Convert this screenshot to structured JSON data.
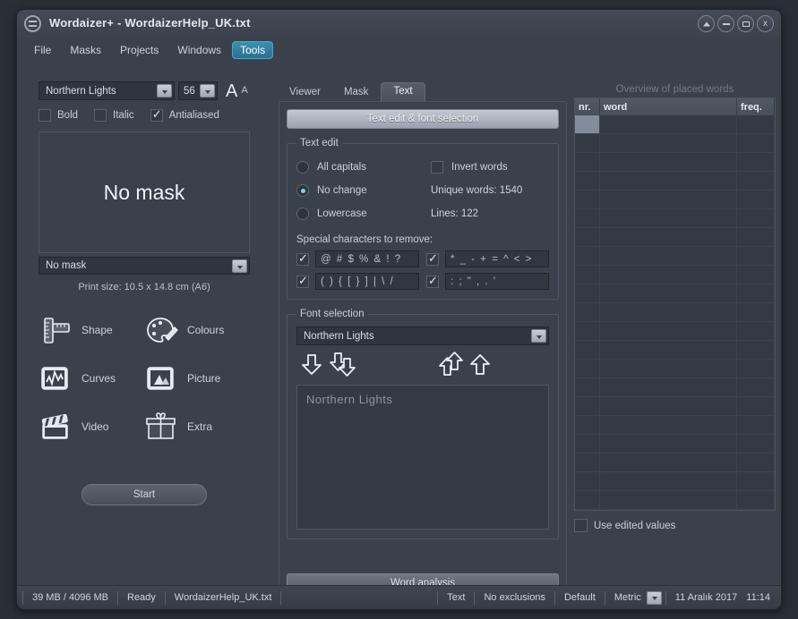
{
  "window": {
    "title": "Wordaizer+ - WordaizerHelp_UK.txt",
    "app_icon": "menu-circle-icon",
    "controls": [
      {
        "name": "rollup-button",
        "glyph": "▲"
      },
      {
        "name": "minimize-button",
        "glyph": "–"
      },
      {
        "name": "maximize-button",
        "glyph": "□"
      },
      {
        "name": "close-button",
        "glyph": "x"
      }
    ]
  },
  "menubar": {
    "items": [
      {
        "label": "File",
        "active": false
      },
      {
        "label": "Masks",
        "active": false
      },
      {
        "label": "Projects",
        "active": false
      },
      {
        "label": "Windows",
        "active": false
      },
      {
        "label": "Tools",
        "active": true
      }
    ],
    "active_color": "#2b7091"
  },
  "left_panel": {
    "font_name": "Northern Lights",
    "font_size": "56",
    "font_big_a": "A",
    "font_small_a": "A",
    "style_checks": [
      {
        "label": "Bold",
        "checked": false
      },
      {
        "label": "Italic",
        "checked": false
      },
      {
        "label": "Antialiased",
        "checked": true
      }
    ],
    "mask_preview_text": "No mask",
    "mask_select_value": "No mask",
    "print_size": "Print size: 10.5 x 14.8 cm (A6)",
    "tools": [
      {
        "label": "Shape",
        "icon": "ruler-icon"
      },
      {
        "label": "Colours",
        "icon": "palette-icon"
      },
      {
        "label": "Curves",
        "icon": "curves-icon"
      },
      {
        "label": "Picture",
        "icon": "picture-icon"
      },
      {
        "label": "Video",
        "icon": "clapperboard-icon"
      },
      {
        "label": "Extra",
        "icon": "gift-icon"
      }
    ],
    "start_label": "Start"
  },
  "center_panel": {
    "tabs": [
      {
        "label": "Viewer",
        "active": false
      },
      {
        "label": "Mask",
        "active": false
      },
      {
        "label": "Text",
        "active": true
      }
    ],
    "header_button": "Text edit & font selection",
    "text_edit": {
      "legend": "Text edit",
      "radios": [
        {
          "label": "All capitals",
          "selected": false
        },
        {
          "label": "No change",
          "selected": true
        },
        {
          "label": "Lowercase",
          "selected": false
        }
      ],
      "invert_words": {
        "label": "Invert words",
        "checked": false
      },
      "unique_words": "Unique words: 1540",
      "lines": "Lines: 122",
      "special_chars_label": "Special characters to remove:",
      "special_chars": [
        {
          "value": "@ # $ % & ! ?",
          "checked": true
        },
        {
          "value": "* _ - + = ^ < >",
          "checked": true
        },
        {
          "value": "( ) { [ } ] | \\ /",
          "checked": true
        },
        {
          "value": ": ; \" , . '",
          "checked": true
        }
      ]
    },
    "font_selection": {
      "legend": "Font selection",
      "font_value": "Northern Lights",
      "arrows": [
        {
          "name": "move-down-one-icon",
          "dir": "down",
          "double": false
        },
        {
          "name": "move-down-all-icon",
          "dir": "down",
          "double": true
        },
        {
          "name": "move-up-all-icon",
          "dir": "up",
          "double": true
        },
        {
          "name": "move-up-one-icon",
          "dir": "up",
          "double": false
        }
      ],
      "preview_text": "Northern Lights"
    },
    "word_analysis_label": "Word analysis"
  },
  "right_panel": {
    "overview_title": "Overview of placed words",
    "columns": [
      "nr.",
      "word",
      "freq."
    ],
    "rows": [],
    "row_count": 21,
    "use_edited_values": {
      "label": "Use edited values",
      "checked": false
    }
  },
  "statusbar": {
    "memory": "39 MB / 4096 MB",
    "state": "Ready",
    "file": "WordaizerHelp_UK.txt",
    "mode": "Text",
    "exclusions": "No exclusions",
    "preset": "Default",
    "units": "Metric",
    "date": "11 Aralık 2017",
    "time": "11:14"
  }
}
